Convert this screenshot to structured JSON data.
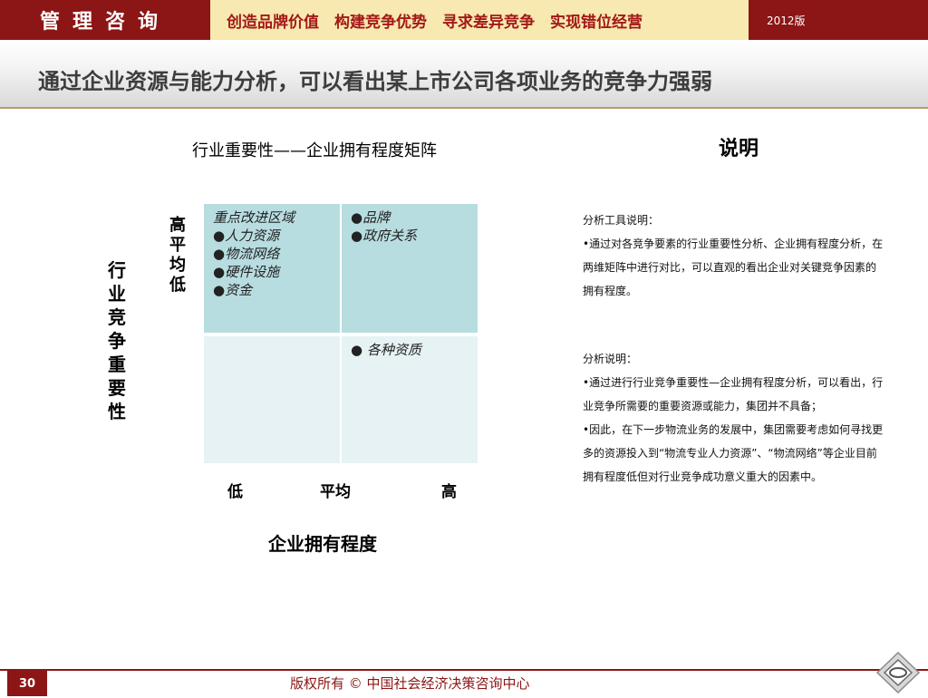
{
  "header": {
    "brand": "管理咨询",
    "slogan": "创造品牌价值　构建竞争优势　寻求差异竞争　实现错位经营",
    "edition": "2012版"
  },
  "title": "通过企业资源与能力分析，可以看出某上市公司各项业务的竞争力强弱",
  "matrix": {
    "title": "行业重要性——企业拥有程度矩阵",
    "y_axis_title": "行业竞争重要性",
    "y_levels": "高平均低",
    "x_ticks": [
      "低",
      "平均",
      "高"
    ],
    "x_axis_title": "企业拥有程度",
    "cells": {
      "top_left": [
        "重点改进区域",
        "●人力资源",
        "●物流网络",
        "●硬件设施",
        "●资金"
      ],
      "top_right": [
        "●品牌",
        "●政府关系"
      ],
      "bottom_left": [],
      "bottom_right": [
        "● 各种资质"
      ]
    },
    "colors": {
      "top": "#b8dde1",
      "bottom": "#e6f2f3"
    }
  },
  "explanation": {
    "heading": "说明",
    "tool_title": "分析工具说明：",
    "tool_text": "•通过对各竞争要素的行业重要性分析、企业拥有程度分析，在两维矩阵中进行对比，可以直观的看出企业对关键竞争因素的拥有程度。",
    "analysis_title": "分析说明：",
    "analysis_text_1": "•通过进行行业竞争重要性—企业拥有程度分析，可以看出，行业竞争所需要的重要资源或能力，集团并不具备；",
    "analysis_text_2": "•因此，在下一步物流业务的发展中，集团需要考虑如何寻找更多的资源投入到“物流专业人力资源”、“物流网络”等企业目前拥有程度低但对行业竞争成功意义重大的因素中。"
  },
  "footer": {
    "page_number": "30",
    "copyright": "版权所有 © 中国社会经济决策咨询中心"
  },
  "theme": {
    "primary": "#8c1515",
    "accent_bg": "#f7e9b0"
  }
}
